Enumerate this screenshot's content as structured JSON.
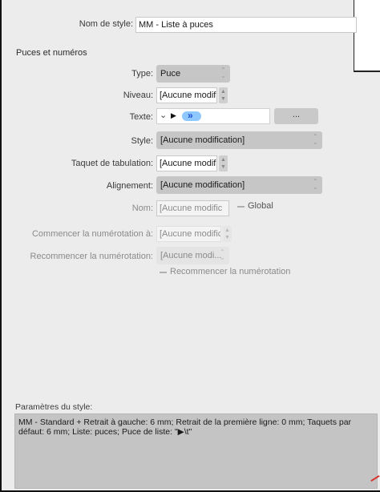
{
  "style_name": {
    "label": "Nom de style:",
    "value": "MM - Liste à puces"
  },
  "section_title": "Puces et numéros",
  "type": {
    "label": "Type:",
    "value": "Puce"
  },
  "niveau": {
    "label": "Niveau:",
    "value": "[Aucune modif"
  },
  "texte": {
    "label": "Texte:",
    "glyph_dropdown": "⌄",
    "glyph_arrow": "▶",
    "glyph_bullet": "»",
    "button_label": "..."
  },
  "style": {
    "label": "Style:",
    "value": "[Aucune modification]"
  },
  "taquet": {
    "label": "Taquet de tabulation:",
    "value": "[Aucune modif"
  },
  "alignement": {
    "label": "Alignement:",
    "value": "[Aucune modification]"
  },
  "nom": {
    "label": "Nom:",
    "value": "[Aucune modific",
    "global_label": "Global"
  },
  "commencer": {
    "label": "Commencer la numérotation à:",
    "value": "[Aucune modific"
  },
  "recommencer": {
    "label": "Recommencer la numérotation:",
    "value": "[Aucune modi...",
    "checkbox_label": "Recommencer la numérotation"
  },
  "params": {
    "label": "Paramètres du style:",
    "text": "MM - Standard + Retrait à gauche: 6 mm; Retrait de la première ligne: 0 mm; Taquets par défaut: 6 mm; Liste: puces; Puce de liste: \"▶\\t\""
  },
  "colors": {
    "chip": "#8fc7ff",
    "chip_text": "#1a4fd6",
    "accent_red": "#d6312a"
  }
}
